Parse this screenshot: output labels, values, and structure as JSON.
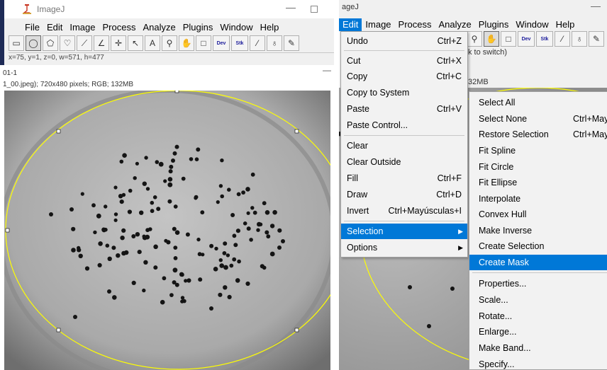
{
  "left": {
    "window_title": "ImageJ",
    "menu": [
      "File",
      "Edit",
      "Image",
      "Process",
      "Analyze",
      "Plugins",
      "Window",
      "Help"
    ],
    "tools": [
      {
        "name": "rectangle-tool-icon",
        "glyph": "▭"
      },
      {
        "name": "oval-tool-icon",
        "glyph": "◯"
      },
      {
        "name": "polygon-tool-icon",
        "glyph": "⬠"
      },
      {
        "name": "freehand-tool-icon",
        "glyph": "♡"
      },
      {
        "name": "line-tool-icon",
        "glyph": "⟋"
      },
      {
        "name": "angle-tool-icon",
        "glyph": "∠"
      },
      {
        "name": "point-tool-icon",
        "glyph": "✛"
      },
      {
        "name": "wand-tool-icon",
        "glyph": "↖"
      },
      {
        "name": "text-tool-icon",
        "glyph": "A"
      },
      {
        "name": "magnifier-tool-icon",
        "glyph": "⚲"
      },
      {
        "name": "hand-tool-icon",
        "glyph": "✋"
      },
      {
        "name": "color-picker-tool-icon",
        "glyph": "□"
      },
      {
        "name": "dev-tool-icon",
        "glyph": "Dev"
      },
      {
        "name": "stk-tool-icon",
        "glyph": "Stk"
      },
      {
        "name": "brush-tool-icon",
        "glyph": "⁄"
      },
      {
        "name": "flood-tool-icon",
        "glyph": "♁"
      },
      {
        "name": "pencil-tool-icon",
        "glyph": "✎"
      }
    ],
    "status": "x=75, y=1, z=0, w=571, h=477",
    "image_title": "01-1",
    "image_info": "1_00.jpeg); 720x480 pixels; RGB; 132MB"
  },
  "right": {
    "window_title": "ageJ",
    "menu": [
      "Edit",
      "Image",
      "Process",
      "Analyze",
      "Plugins",
      "Window",
      "Help"
    ],
    "status": "k to switch)",
    "size": "32MB",
    "edit_menu": [
      {
        "label": "Undo",
        "shortcut": "Ctrl+Z"
      },
      {
        "label": "Cut",
        "shortcut": "Ctrl+X"
      },
      {
        "label": "Copy",
        "shortcut": "Ctrl+C"
      },
      {
        "label": "Copy to System",
        "shortcut": ""
      },
      {
        "label": "Paste",
        "shortcut": "Ctrl+V"
      },
      {
        "label": "Paste Control...",
        "shortcut": ""
      },
      {
        "label": "Clear",
        "shortcut": ""
      },
      {
        "label": "Clear Outside",
        "shortcut": ""
      },
      {
        "label": "Fill",
        "shortcut": "Ctrl+F"
      },
      {
        "label": "Draw",
        "shortcut": "Ctrl+D"
      },
      {
        "label": "Invert",
        "shortcut": "Ctrl+Mayúsculas+I"
      },
      {
        "label": "Selection",
        "shortcut": ""
      },
      {
        "label": "Options",
        "shortcut": ""
      }
    ],
    "selection_menu": [
      {
        "label": "Select All",
        "shortcut": ""
      },
      {
        "label": "Select None",
        "shortcut": "Ctrl+May"
      },
      {
        "label": "Restore Selection",
        "shortcut": "Ctrl+May"
      },
      {
        "label": "Fit Spline",
        "shortcut": ""
      },
      {
        "label": "Fit Circle",
        "shortcut": ""
      },
      {
        "label": "Fit Ellipse",
        "shortcut": ""
      },
      {
        "label": "Interpolate",
        "shortcut": ""
      },
      {
        "label": "Convex Hull",
        "shortcut": ""
      },
      {
        "label": "Make Inverse",
        "shortcut": ""
      },
      {
        "label": "Create Selection",
        "shortcut": ""
      },
      {
        "label": "Create Mask",
        "shortcut": ""
      },
      {
        "label": "Properties...",
        "shortcut": ""
      },
      {
        "label": "Scale...",
        "shortcut": ""
      },
      {
        "label": "Rotate...",
        "shortcut": ""
      },
      {
        "label": "Enlarge...",
        "shortcut": ""
      },
      {
        "label": "Make Band...",
        "shortcut": ""
      },
      {
        "label": "Specify...",
        "shortcut": ""
      }
    ]
  },
  "colors": {
    "highlight": "#0078d7",
    "roi": "#ffff00"
  }
}
